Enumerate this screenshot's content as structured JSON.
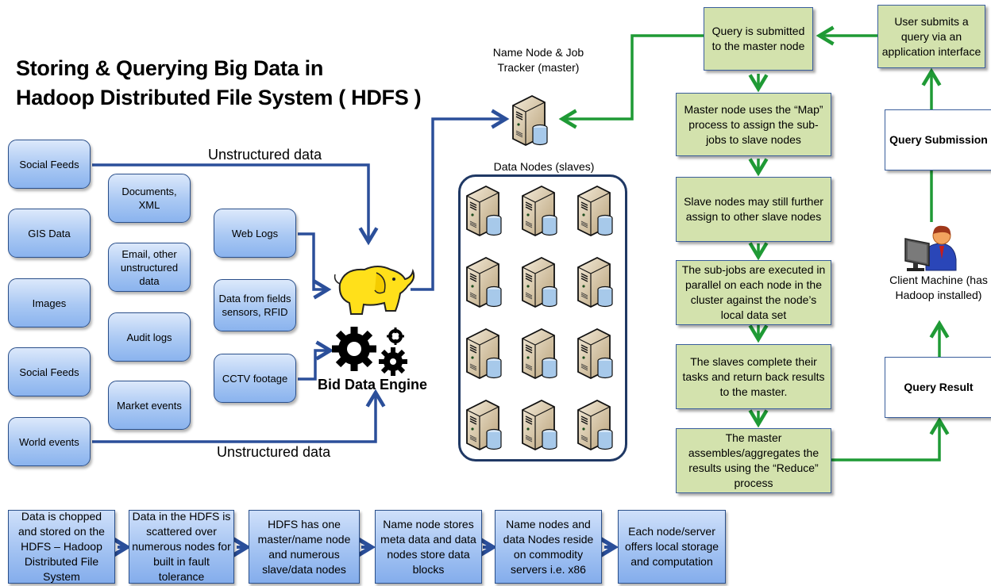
{
  "title": {
    "line1": "Storing & Querying Big Data in",
    "line2": "Hadoop Distributed File System ( HDFS )"
  },
  "sources": {
    "col1": [
      "Social Feeds",
      "GIS Data",
      "Images",
      "Social Feeds",
      "World events"
    ],
    "col2": [
      "Documents, XML",
      "Email, other unstructured data",
      "Audit logs",
      "Market events"
    ],
    "col3": [
      "Web Logs",
      "Data from fields sensors, RFID",
      "CCTV footage"
    ]
  },
  "labels": {
    "unstructured_top": "Unstructured data",
    "unstructured_bottom": "Unstructured data",
    "engine": "Bid Data  Engine",
    "name_node": "Name Node & Job Tracker (master)",
    "data_nodes": "Data Nodes (slaves)",
    "client_machine": "Client Machine (has Hadoop installed)"
  },
  "icons": {
    "hadoop": "hadoop-elephant-icon",
    "gears": "gears-icon",
    "server": "server-with-database-icon",
    "client": "user-at-computer-icon"
  },
  "data_nodes_count": 12,
  "query_flow": [
    "Query is submitted  to the master node",
    "Master node uses the “Map” process to assign the sub-jobs  to slave nodes",
    "Slave nodes may still further assign to other slave nodes",
    "The sub-jobs  are executed in parallel  on each node  in the cluster against the node’s local data set",
    "The slaves complete their tasks and return back results to the  master.",
    "The master assembles/aggregates the results using the “Reduce” process"
  ],
  "client_flow": {
    "user_submits": "User submits a query via an application interface",
    "query_submission": "Query Submission",
    "query_result": "Query Result"
  },
  "hdfs_steps": [
    "Data is chopped and stored on the HDFS – Hadoop Distributed File System",
    "Data in the HDFS is scattered over numerous nodes for built in fault tolerance",
    "HDFS has one master/name node and numerous slave/data nodes",
    "Name node stores meta data and data nodes store data blocks",
    "Name nodes  and data Nodes reside on commodity servers i.e. x86",
    "Each node/server offers local storage and computation"
  ],
  "colors": {
    "blue_arrow": "#2b4f9a",
    "green_arrow": "#1f9a35",
    "green_box": "#d3e2ad",
    "box_border": "#3a5e9c"
  }
}
